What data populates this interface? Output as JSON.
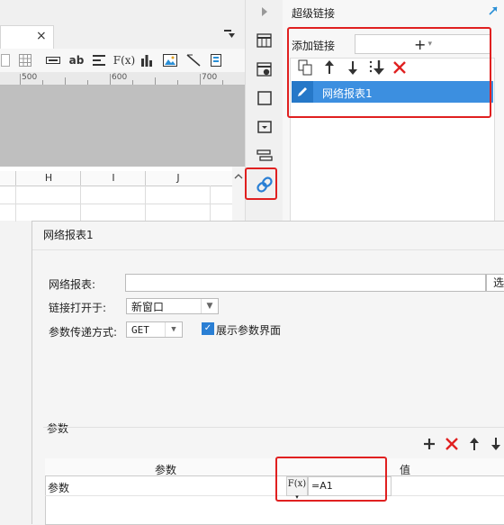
{
  "report_tab": {
    "close_icon": "×",
    "menu_icon": "▼"
  },
  "toolbar": {
    "icons": [
      "sheet-icon",
      "grid-icon",
      "merge-icon",
      "text-style-icon",
      "align-icon",
      "formula-icon",
      "chart-icon",
      "image-icon",
      "slash-icon",
      "frame-icon"
    ],
    "labels": {
      "ab": "ab",
      "fx": "F(x)"
    }
  },
  "ruler": {
    "marks": [
      "500",
      "600",
      "700"
    ]
  },
  "columns": [
    "H",
    "I",
    "J"
  ],
  "side_strip": {
    "icons": [
      "expand-arrow-icon",
      "cell-element-icon",
      "cell-attr-icon",
      "border-icon",
      "widget-icon",
      "condition-icon",
      "hyperlink-icon"
    ]
  },
  "hyperlink_panel": {
    "title": "超级链接",
    "add_label": "添加链接",
    "add_button": "+",
    "items": [
      {
        "label": "网络报表1"
      }
    ]
  },
  "dialog": {
    "title": "网络报表1",
    "report_label": "网络报表:",
    "report_value": "",
    "select_button": "选",
    "open_label": "链接打开于:",
    "open_value": "新窗口",
    "method_label": "参数传递方式:",
    "method_value": "GET",
    "show_param_label": "展示参数界面",
    "show_param_checked": true,
    "param_section": "参数",
    "table": {
      "headers": [
        "参数",
        "值"
      ],
      "rows": [
        {
          "param": "参数",
          "value": "=A1",
          "formula_button": "F(x)"
        }
      ]
    }
  },
  "colors": {
    "accent": "#3c8fe0",
    "highlight": "#e02020",
    "delete": "#e02020"
  }
}
